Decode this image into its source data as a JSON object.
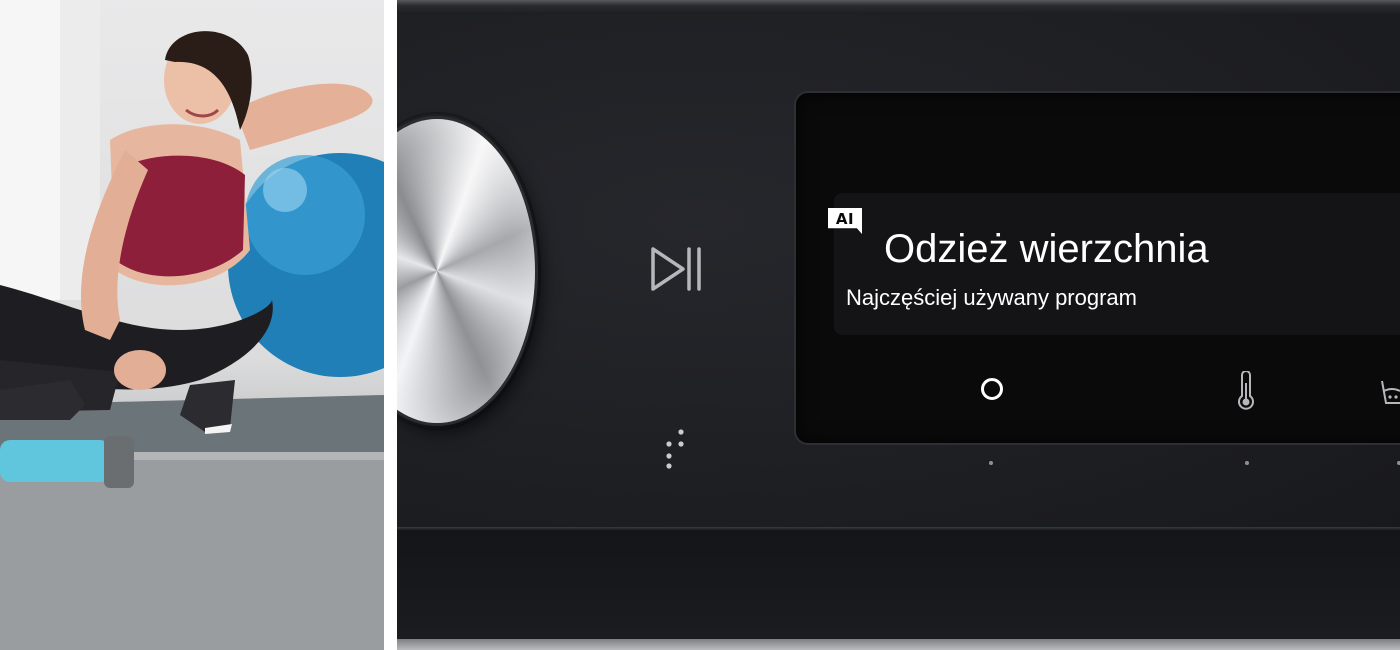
{
  "photo": {
    "description_icon": "woman-with-fitness-ball-photo"
  },
  "appliance": {
    "controls": {
      "dial_icon": "dial-knob",
      "play_pause_icon": "play-pause-icon",
      "braille_icon": "braille-dots"
    },
    "display": {
      "badge": "AI",
      "program_name": "Odzież wierzchnia",
      "subtitle": "Najczęściej używany program",
      "icons": [
        "ring-icon",
        "thermometer-icon",
        "basket-icon"
      ]
    },
    "colors": {
      "panel": "#1e1f23",
      "display": "#0a0a0b",
      "text": "#ffffff",
      "icon": "#b5b7bb"
    }
  }
}
